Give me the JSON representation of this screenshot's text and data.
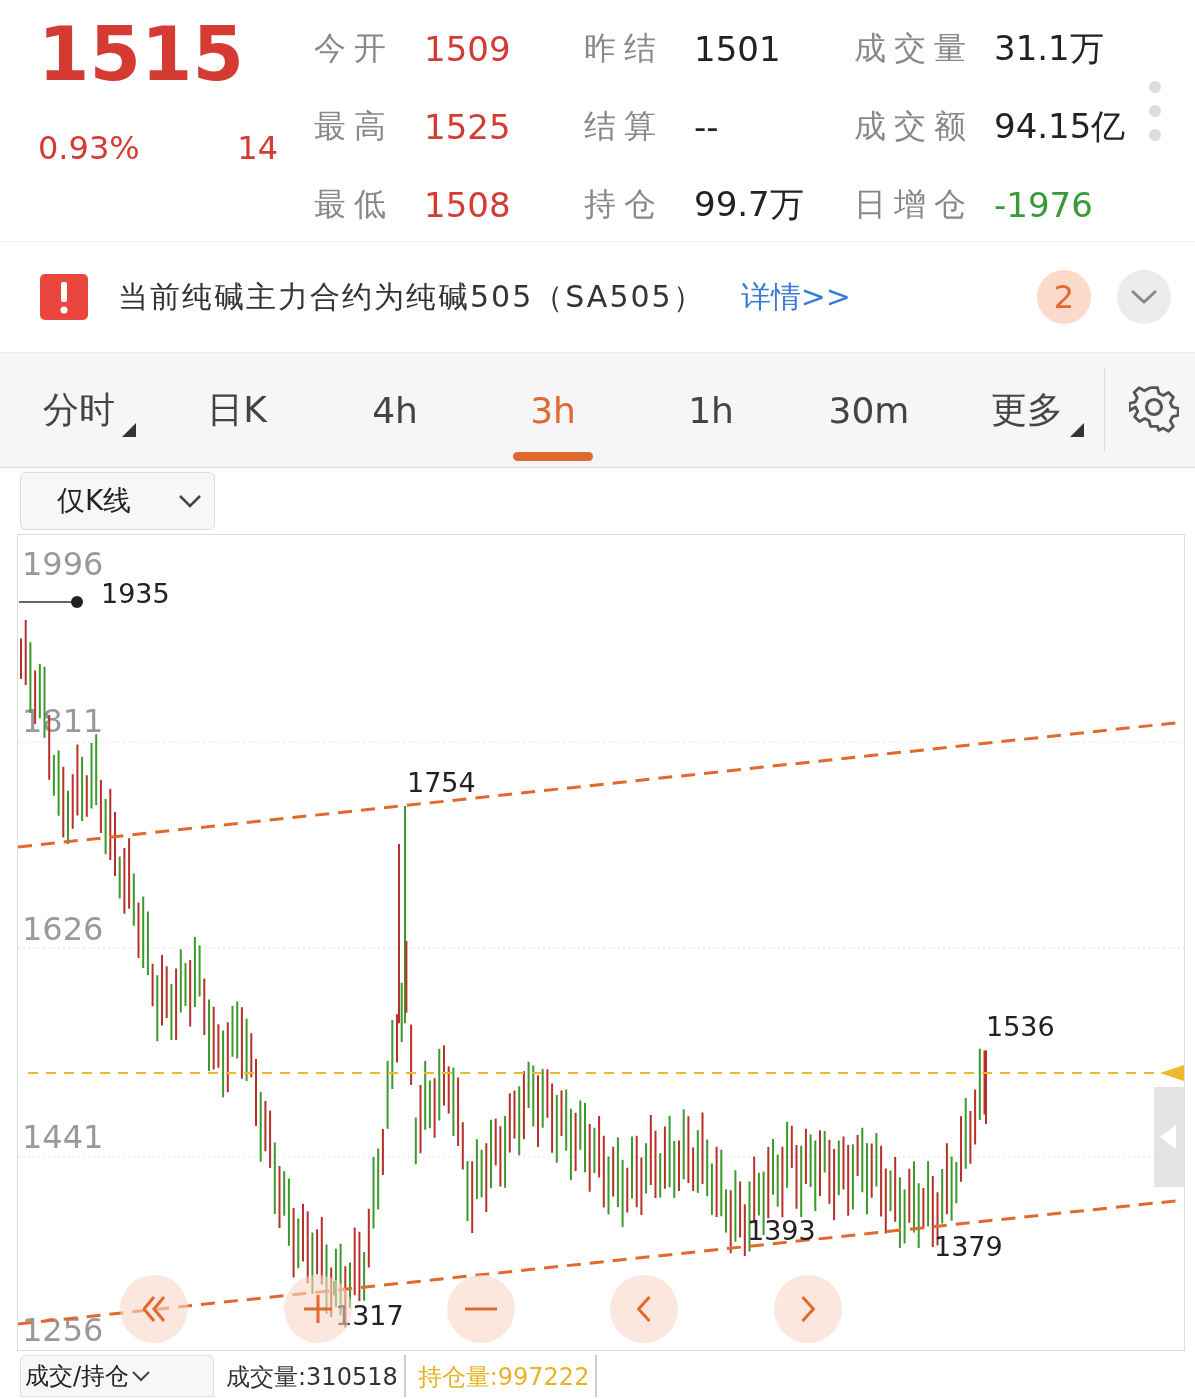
{
  "quote": {
    "price": "1515",
    "change_pct": "0.93%",
    "change": "14"
  },
  "stats": [
    {
      "label": "今开",
      "value": "1509",
      "color": "#d43c33"
    },
    {
      "label": "昨结",
      "value": "1501",
      "color": "#222222"
    },
    {
      "label": "成交量",
      "value": "31.1万",
      "color": "#222222"
    },
    {
      "label": "最高",
      "value": "1525",
      "color": "#d43c33"
    },
    {
      "label": "结算",
      "value": "--",
      "color": "#222222"
    },
    {
      "label": "成交额",
      "value": "94.15亿",
      "color": "#222222"
    },
    {
      "label": "最低",
      "value": "1508",
      "color": "#d43c33"
    },
    {
      "label": "持仓",
      "value": "99.7万",
      "color": "#222222"
    },
    {
      "label": "日增仓",
      "value": "-1976",
      "color": "#3a9a3a"
    }
  ],
  "notice": {
    "text": "当前纯碱主力合约为纯碱505（SA505）",
    "link": "详情>>",
    "badge": "2"
  },
  "periods": [
    {
      "label": "分时",
      "selected": false,
      "menu": true
    },
    {
      "label": "日K",
      "selected": false,
      "menu": false
    },
    {
      "label": "4h",
      "selected": false,
      "menu": false
    },
    {
      "label": "3h",
      "selected": true,
      "menu": false
    },
    {
      "label": "1h",
      "selected": false,
      "menu": false
    },
    {
      "label": "30m",
      "selected": false,
      "menu": false
    },
    {
      "label": "更多",
      "selected": false,
      "menu": true
    }
  ],
  "chart_mode": "仅K线",
  "chart": {
    "y_ticks": [
      "1996",
      "1811",
      "1626",
      "1441",
      "1256"
    ],
    "marks": [
      "1935",
      "1754",
      "1536",
      "1393",
      "1379",
      "1317"
    ]
  },
  "indicator_bar": {
    "selector": "成交/持仓",
    "items": [
      {
        "text": "成交量:310518",
        "color": "#333333"
      },
      {
        "text": "持仓量:997222",
        "color": "#e6b422"
      }
    ]
  }
}
